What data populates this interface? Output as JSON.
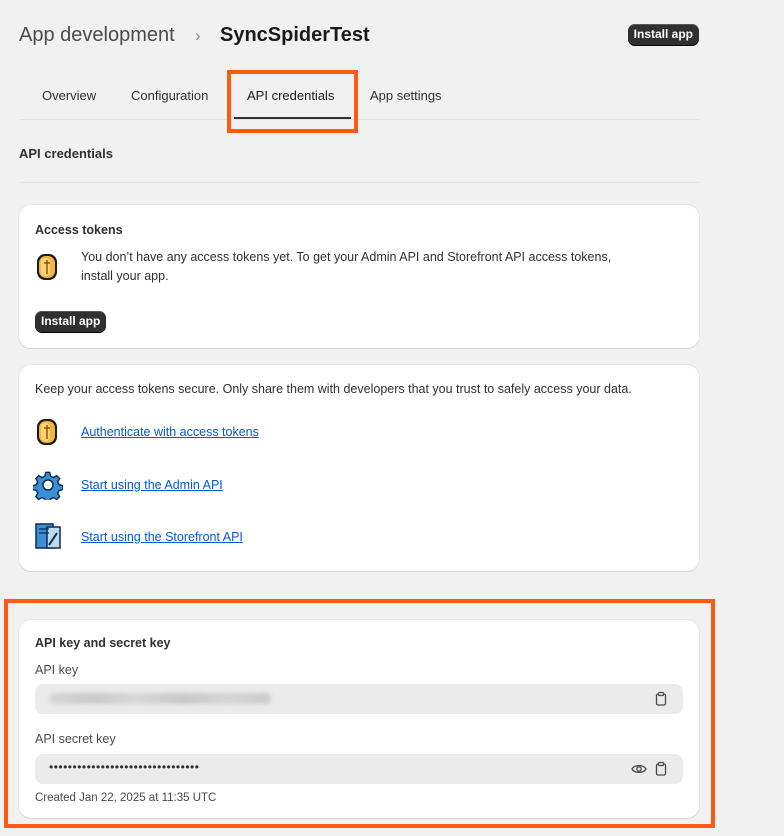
{
  "breadcrumb": {
    "parent": "App development",
    "separator": "›",
    "title": "SyncSpiderTest"
  },
  "header": {
    "install_label": "Install app"
  },
  "tabs": [
    {
      "label": "Overview",
      "active": false
    },
    {
      "label": "Configuration",
      "active": false
    },
    {
      "label": "API credentials",
      "active": true
    },
    {
      "label": "App settings",
      "active": false
    }
  ],
  "section_title": "API credentials",
  "access_tokens": {
    "heading": "Access tokens",
    "line1": "You don’t have any access tokens yet. To get your Admin API and Storefront API access tokens,",
    "line2": "install your app.",
    "install_label": "Install app"
  },
  "secure": {
    "text": "Keep your access tokens secure. Only share them with developers that you trust to safely access your data.",
    "links": [
      {
        "label": "Authenticate with access tokens",
        "icon": "coin-icon"
      },
      {
        "label": "Start using the Admin API",
        "icon": "gear-icon"
      },
      {
        "label": "Start using the Storefront API",
        "icon": "storefront-icon"
      }
    ]
  },
  "keys": {
    "heading": "API key and secret key",
    "api_key_label": "API key",
    "secret_label": "API secret key",
    "secret_masked": "••••••••••••••••••••••••••••••••",
    "created": "Created Jan 22, 2025 at 11:35 UTC"
  },
  "colors": {
    "highlight": "#ff5a14",
    "link": "#005bd3",
    "button": "#303030"
  }
}
